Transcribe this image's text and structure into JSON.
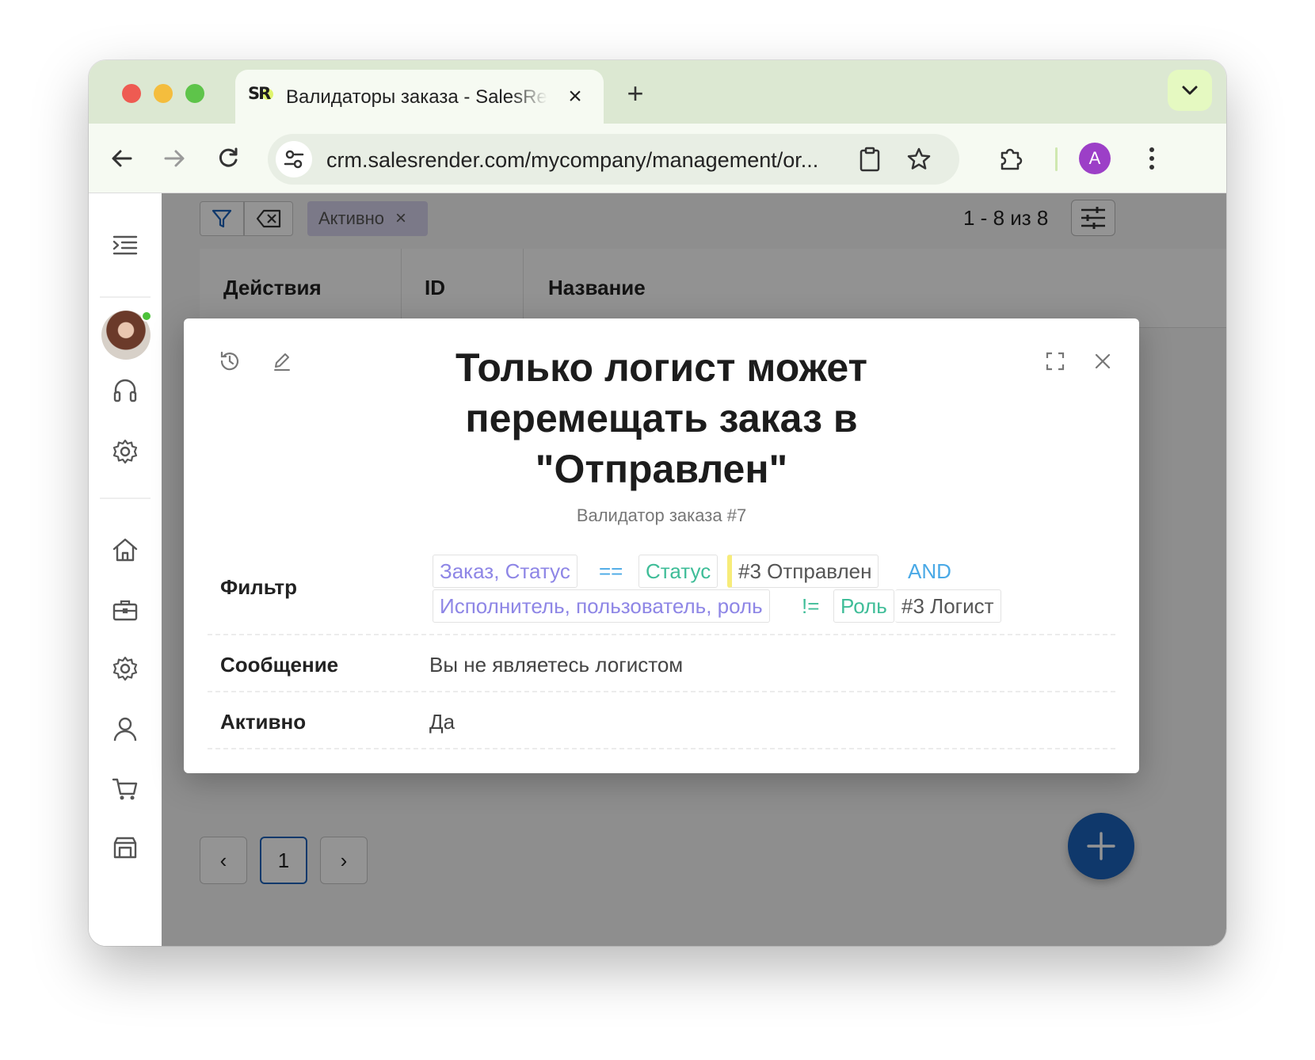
{
  "browser": {
    "tab_title": "Валидаторы заказа - SalesRender",
    "tab_favicon": "SR",
    "url": "crm.salesrender.com/mycompany/management/or...",
    "profile_initial": "A",
    "accent_color": "#dce8d2",
    "profile_color": "#9c3fc7"
  },
  "toolbar_icons": [
    "back-icon",
    "forward-icon",
    "reload-icon",
    "site-settings-icon",
    "clipboard-icon",
    "bookmark-star-icon",
    "extensions-icon",
    "menu-kebab-icon"
  ],
  "sidebar": {
    "icons": [
      "menu-indent-icon",
      "headset-icon",
      "gear-icon",
      "home-icon",
      "briefcase-icon",
      "gear-icon",
      "user-icon",
      "cart-icon",
      "warehouse-icon"
    ]
  },
  "list": {
    "active_filter_chip": "Активно",
    "range": "1 - 8 из 8",
    "columns": [
      "Действия",
      "ID",
      "Название"
    ],
    "current_page": "1"
  },
  "modal": {
    "title": "Только логист может перемещать заказ в \"Отправлен\"",
    "subtitle": "Валидатор заказа #7",
    "rows": {
      "filter_label": "Фильтр",
      "message_label": "Сообщение",
      "message_value": "Вы не являетесь логистом",
      "active_label": "Активно",
      "active_value": "Да"
    },
    "filter": {
      "line1": {
        "field": "Заказ, Статус",
        "operator": "==",
        "class": "Статус",
        "value": "#3 Отправлен",
        "joiner": "AND"
      },
      "line2": {
        "field": "Исполнитель, пользователь, роль",
        "operator": "!=",
        "class": "Роль",
        "value": "#3 Логист"
      }
    },
    "colors": {
      "field": "#8e86e6",
      "class": "#3fbd98",
      "operator": "#4aa9e6",
      "status_accent": "#f7ec7a"
    }
  },
  "fab_color": "#1b61b8"
}
